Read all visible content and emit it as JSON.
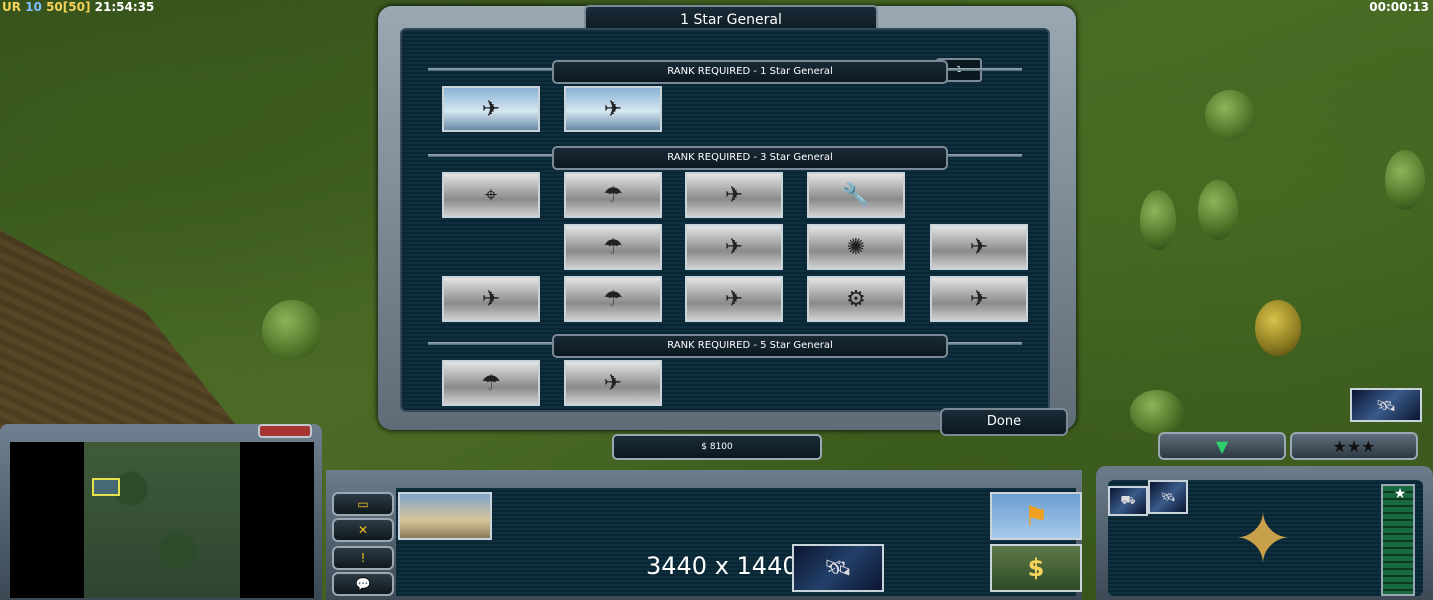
{
  "hud": {
    "top_left": {
      "part1": "UR",
      "part2": "10",
      "part3": "50[50]",
      "clock": "21:54:35"
    },
    "timer": "00:00:13"
  },
  "promotion_panel": {
    "title": "1 Star General",
    "points": "1",
    "done_label": "Done",
    "ranks": [
      {
        "header": "RANK REQUIRED - 1 Star General",
        "abilities": [
          {
            "icon": "drone-icon",
            "glyph": "✈",
            "unlocked": true
          },
          {
            "icon": "stealth-jet-icon",
            "glyph": "✈",
            "unlocked": true
          }
        ]
      },
      {
        "header": "RANK REQUIRED - 3 Star General",
        "abilities": [
          {
            "icon": "sniper-icon",
            "glyph": "⌖",
            "unlocked": false
          },
          {
            "icon": "paradrop-icon",
            "glyph": "☂",
            "unlocked": false
          },
          {
            "icon": "a10-strike-icon",
            "glyph": "✈",
            "unlocked": false
          },
          {
            "icon": "repair-wrench-icon",
            "glyph": "🔧",
            "unlocked": false
          },
          {
            "icon": "paradrop-2-icon",
            "glyph": "☂",
            "unlocked": false
          },
          {
            "icon": "a10-strike-2-icon",
            "glyph": "✈",
            "unlocked": false
          },
          {
            "icon": "emp-blast-icon",
            "glyph": "✺",
            "unlocked": false
          },
          {
            "icon": "spectre-gunship-icon",
            "glyph": "✈",
            "unlocked": false
          },
          {
            "icon": "carpet-bomb-icon",
            "glyph": "✈",
            "unlocked": false
          },
          {
            "icon": "paradrop-3-icon",
            "glyph": "☂",
            "unlocked": false
          },
          {
            "icon": "a10-strike-3-icon",
            "glyph": "✈",
            "unlocked": false
          },
          {
            "icon": "repair-3-icon",
            "glyph": "⚙",
            "unlocked": false
          },
          {
            "icon": "spectre-gunship-2-icon",
            "glyph": "✈",
            "unlocked": false
          }
        ]
      },
      {
        "header": "RANK REQUIRED - 5 Star General",
        "abilities": [
          {
            "icon": "supply-drop-icon",
            "glyph": "☂",
            "unlocked": false
          },
          {
            "icon": "fuel-air-bomb-icon",
            "glyph": "✈",
            "unlocked": false
          }
        ]
      }
    ]
  },
  "command_bar": {
    "money": "$ 8100",
    "resolution_text": "3440 x 1440",
    "side_buttons": [
      {
        "icon": "select-units-icon",
        "glyph": "▭"
      },
      {
        "icon": "crossed-swords-icon",
        "glyph": "✕"
      },
      {
        "icon": "alert-icon",
        "glyph": "!"
      },
      {
        "icon": "chat-icon",
        "glyph": "💬"
      }
    ]
  },
  "colors": {
    "panel_bg": "#0e2f3f",
    "accent_green": "#2bd06a",
    "hud_yellow": "#f4d35a"
  }
}
